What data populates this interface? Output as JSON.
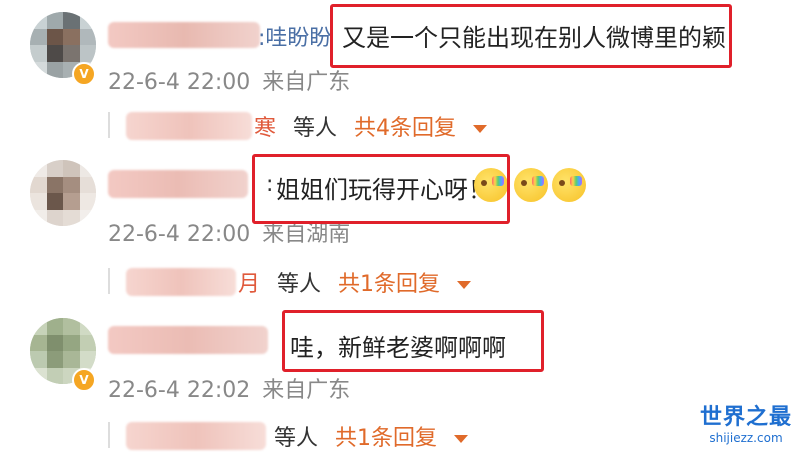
{
  "comments": [
    {
      "name_suffix": ":哇盼盼",
      "text": "又是一个只能出现在别人微博里的颖",
      "date": "22-6-4 22:00",
      "source": "来自广东",
      "reply_tail": "寒",
      "reply_wait": "等人",
      "reply_count": "共4条回复"
    },
    {
      "name_suffix": ":",
      "text": "姐姐们玩得开心呀！",
      "date": "22-6-4 22:00",
      "source": "来自湖南",
      "reply_tail": "月",
      "reply_wait": "等人",
      "reply_count": "共1条回复"
    },
    {
      "name_suffix": "",
      "text": "哇，新鲜老婆啊啊啊",
      "date": "22-6-4 22:02",
      "source": "来自广东",
      "reply_tail": "",
      "reply_wait": "等人",
      "reply_count": "共1条回复"
    }
  ],
  "icons": {
    "verified": "verified-badge-icon",
    "expand": "triangle-down-icon",
    "emoji": "happy-rainbow-emoji-icon"
  },
  "colors": {
    "highlight": "#e0202a",
    "reply_link": "#e06a2a",
    "meta": "#888888"
  },
  "watermark": {
    "cn": "世界之最",
    "en": "shijiezz.com"
  }
}
